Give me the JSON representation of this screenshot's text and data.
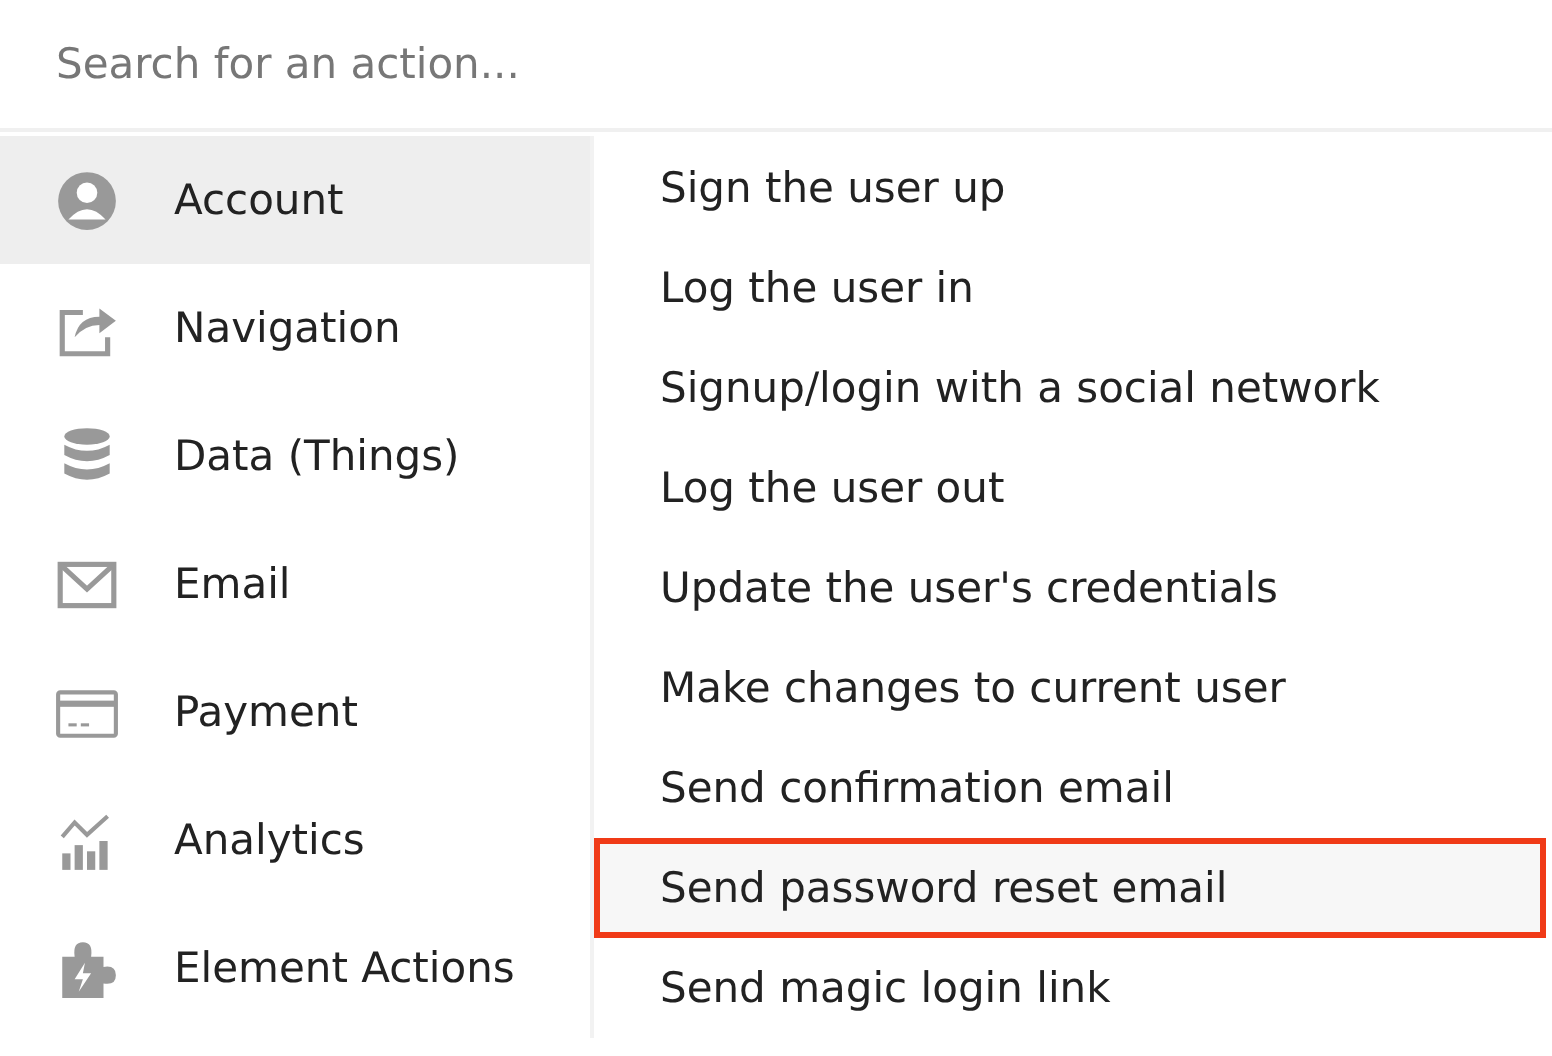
{
  "search": {
    "placeholder": "Search for an action..."
  },
  "categories": [
    {
      "label": "Account",
      "selected": true
    },
    {
      "label": "Navigation",
      "selected": false
    },
    {
      "label": "Data (Things)",
      "selected": false
    },
    {
      "label": "Email",
      "selected": false
    },
    {
      "label": "Payment",
      "selected": false
    },
    {
      "label": "Analytics",
      "selected": false
    },
    {
      "label": "Element Actions",
      "selected": false
    }
  ],
  "actions": [
    {
      "label": "Sign the user up",
      "highlighted": false
    },
    {
      "label": "Log the user in",
      "highlighted": false
    },
    {
      "label": "Signup/login with a social network",
      "highlighted": false
    },
    {
      "label": "Log the user out",
      "highlighted": false
    },
    {
      "label": "Update the user's credentials",
      "highlighted": false
    },
    {
      "label": "Make changes to current user",
      "highlighted": false
    },
    {
      "label": "Send confirmation email",
      "highlighted": false
    },
    {
      "label": "Send password reset email",
      "highlighted": true
    },
    {
      "label": "Send magic login link",
      "highlighted": false
    }
  ]
}
